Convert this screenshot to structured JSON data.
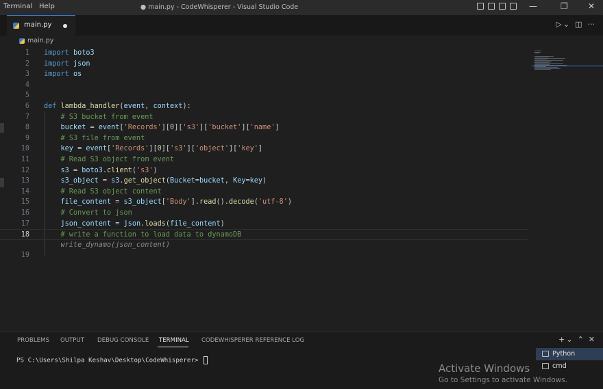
{
  "titlebar": {
    "menu": [
      "Terminal",
      "Help"
    ],
    "title": "● main.py - CodeWhisperer - Visual Studio Code",
    "controls": {
      "minimize": "—",
      "maximize": "❐",
      "close": "✕"
    }
  },
  "tabs": [
    {
      "label": "main.py",
      "dirty": true
    }
  ],
  "tab_actions": {
    "run": "▷",
    "run_dropdown": "⌄",
    "split": "◫",
    "more": "···"
  },
  "breadcrumb": {
    "file": "main.py"
  },
  "editor": {
    "active_line": 18,
    "lines": [
      {
        "n": "1",
        "tokens": [
          {
            "t": "import",
            "c": "kw"
          },
          {
            "t": " boto3",
            "c": "va"
          }
        ]
      },
      {
        "n": "2",
        "tokens": [
          {
            "t": "import",
            "c": "kw"
          },
          {
            "t": " json",
            "c": "va"
          }
        ]
      },
      {
        "n": "3",
        "tokens": [
          {
            "t": "import",
            "c": "kw"
          },
          {
            "t": " os",
            "c": "va"
          }
        ]
      },
      {
        "n": "4",
        "tokens": []
      },
      {
        "n": "5",
        "tokens": []
      },
      {
        "n": "6",
        "tokens": [
          {
            "t": "def ",
            "c": "kw"
          },
          {
            "t": "lambda_handler",
            "c": "fn"
          },
          {
            "t": "(",
            "c": ""
          },
          {
            "t": "event",
            "c": "va"
          },
          {
            "t": ", ",
            "c": ""
          },
          {
            "t": "context",
            "c": "va"
          },
          {
            "t": "):",
            "c": ""
          }
        ]
      },
      {
        "n": "7",
        "tokens": [
          {
            "t": "    # S3 bucket from event",
            "c": "cm"
          }
        ]
      },
      {
        "n": "8",
        "tokens": [
          {
            "t": "    bucket",
            "c": "va"
          },
          {
            "t": " = ",
            "c": ""
          },
          {
            "t": "event",
            "c": "va"
          },
          {
            "t": "[",
            "c": ""
          },
          {
            "t": "'Records'",
            "c": "st"
          },
          {
            "t": "][",
            "c": ""
          },
          {
            "t": "0",
            "c": "nu"
          },
          {
            "t": "][",
            "c": ""
          },
          {
            "t": "'s3'",
            "c": "st"
          },
          {
            "t": "][",
            "c": ""
          },
          {
            "t": "'bucket'",
            "c": "st"
          },
          {
            "t": "][",
            "c": ""
          },
          {
            "t": "'name'",
            "c": "st"
          },
          {
            "t": "]",
            "c": ""
          }
        ]
      },
      {
        "n": "9",
        "tokens": [
          {
            "t": "    # S3 file from event",
            "c": "cm"
          }
        ]
      },
      {
        "n": "10",
        "tokens": [
          {
            "t": "    key",
            "c": "va"
          },
          {
            "t": " = ",
            "c": ""
          },
          {
            "t": "event",
            "c": "va"
          },
          {
            "t": "[",
            "c": ""
          },
          {
            "t": "'Records'",
            "c": "st"
          },
          {
            "t": "][",
            "c": ""
          },
          {
            "t": "0",
            "c": "nu"
          },
          {
            "t": "][",
            "c": ""
          },
          {
            "t": "'s3'",
            "c": "st"
          },
          {
            "t": "][",
            "c": ""
          },
          {
            "t": "'object'",
            "c": "st"
          },
          {
            "t": "][",
            "c": ""
          },
          {
            "t": "'key'",
            "c": "st"
          },
          {
            "t": "]",
            "c": ""
          }
        ]
      },
      {
        "n": "11",
        "tokens": [
          {
            "t": "    # Read S3 object from event",
            "c": "cm"
          }
        ]
      },
      {
        "n": "12",
        "tokens": [
          {
            "t": "    s3",
            "c": "va"
          },
          {
            "t": " = ",
            "c": ""
          },
          {
            "t": "boto3",
            "c": "va"
          },
          {
            "t": ".",
            "c": ""
          },
          {
            "t": "client",
            "c": "fn"
          },
          {
            "t": "(",
            "c": ""
          },
          {
            "t": "'s3'",
            "c": "st"
          },
          {
            "t": ")",
            "c": ""
          }
        ]
      },
      {
        "n": "13",
        "tokens": [
          {
            "t": "    s3_object",
            "c": "va"
          },
          {
            "t": " = ",
            "c": ""
          },
          {
            "t": "s3",
            "c": "va"
          },
          {
            "t": ".",
            "c": ""
          },
          {
            "t": "get_object",
            "c": "fn"
          },
          {
            "t": "(",
            "c": ""
          },
          {
            "t": "Bucket",
            "c": "va"
          },
          {
            "t": "=",
            "c": ""
          },
          {
            "t": "bucket",
            "c": "va"
          },
          {
            "t": ", ",
            "c": ""
          },
          {
            "t": "Key",
            "c": "va"
          },
          {
            "t": "=",
            "c": ""
          },
          {
            "t": "key",
            "c": "va"
          },
          {
            "t": ")",
            "c": ""
          }
        ]
      },
      {
        "n": "14",
        "tokens": [
          {
            "t": "    # Read S3 object content",
            "c": "cm"
          }
        ]
      },
      {
        "n": "15",
        "tokens": [
          {
            "t": "    file_content",
            "c": "va"
          },
          {
            "t": " = ",
            "c": ""
          },
          {
            "t": "s3_object",
            "c": "va"
          },
          {
            "t": "[",
            "c": ""
          },
          {
            "t": "'Body'",
            "c": "st"
          },
          {
            "t": "].",
            "c": ""
          },
          {
            "t": "read",
            "c": "fn"
          },
          {
            "t": "().",
            "c": ""
          },
          {
            "t": "decode",
            "c": "fn"
          },
          {
            "t": "(",
            "c": ""
          },
          {
            "t": "'utf-8'",
            "c": "st"
          },
          {
            "t": ")",
            "c": ""
          }
        ]
      },
      {
        "n": "16",
        "tokens": [
          {
            "t": "    # Convert to json",
            "c": "cm"
          }
        ]
      },
      {
        "n": "17",
        "tokens": [
          {
            "t": "    json_content",
            "c": "va"
          },
          {
            "t": " = ",
            "c": ""
          },
          {
            "t": "json",
            "c": "va"
          },
          {
            "t": ".",
            "c": ""
          },
          {
            "t": "loads",
            "c": "fn"
          },
          {
            "t": "(",
            "c": ""
          },
          {
            "t": "file_content",
            "c": "va"
          },
          {
            "t": ")",
            "c": ""
          }
        ]
      },
      {
        "n": "18",
        "tokens": [
          {
            "t": "    # write a function to load data to dynamoDB",
            "c": "cm"
          }
        ]
      },
      {
        "n": "",
        "tokens": [
          {
            "t": "    write_dynamo(json_content)",
            "c": "gh"
          }
        ]
      },
      {
        "n": "19",
        "tokens": []
      }
    ]
  },
  "panel": {
    "tabs": [
      "PROBLEMS",
      "OUTPUT",
      "DEBUG CONSOLE",
      "TERMINAL",
      "CODEWHISPERER REFERENCE LOG"
    ],
    "active_tab": "TERMINAL",
    "actions": {
      "add": "+",
      "add_dropdown": "⌄",
      "maximize": "⌃",
      "close": "✕"
    },
    "prompt": "PS C:\\Users\\Shilpa Keshav\\Desktop\\CodeWhisperer> "
  },
  "terminals": [
    {
      "label": "Python",
      "selected": true
    },
    {
      "label": "cmd",
      "selected": false
    }
  ],
  "watermark": {
    "title": "Activate Windows",
    "subtitle": "Go to Settings to activate Windows."
  }
}
